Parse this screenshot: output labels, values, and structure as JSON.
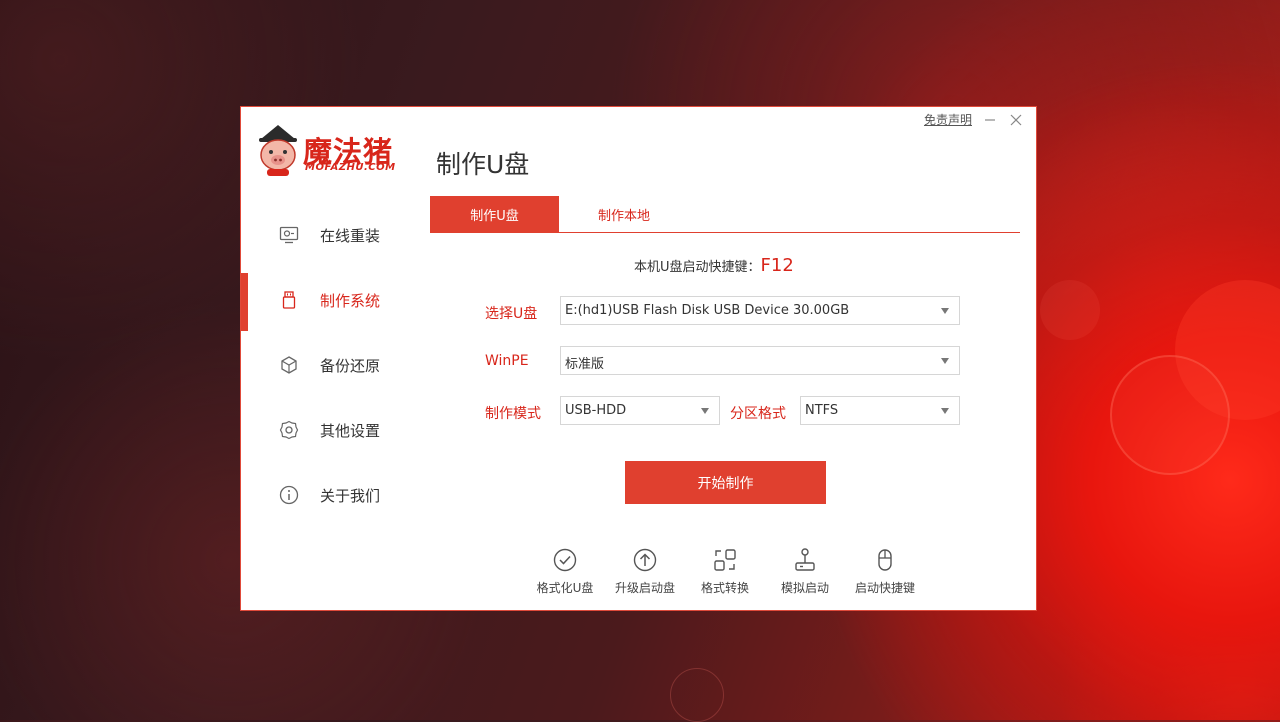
{
  "brand": {
    "logo_text": "魔法猪",
    "logo_sub": "MOFAZHU.COM",
    "accent_color": "#e0402f"
  },
  "window": {
    "title": "制作U盘",
    "disclaimer": "免责声明",
    "minimize_icon": "minimize-icon",
    "close_icon": "close-icon"
  },
  "sidebar": {
    "items": [
      {
        "label": "在线重装",
        "icon": "monitor-icon",
        "active": false
      },
      {
        "label": "制作系统",
        "icon": "usb-drive-icon",
        "active": true
      },
      {
        "label": "备份还原",
        "icon": "backup-cube-icon",
        "active": false
      },
      {
        "label": "其他设置",
        "icon": "gear-icon",
        "active": false
      },
      {
        "label": "关于我们",
        "icon": "info-icon",
        "active": false
      }
    ]
  },
  "tabs": [
    {
      "label": "制作U盘",
      "active": true
    },
    {
      "label": "制作本地",
      "active": false
    }
  ],
  "hotkey": {
    "label": "本机U盘启动快捷键：",
    "key": "F12"
  },
  "form": {
    "usb_label": "选择U盘",
    "usb_value": "E:(hd1)USB Flash Disk USB Device 30.00GB",
    "winpe_label": "WinPE",
    "winpe_value": "标准版",
    "mode_label": "制作模式",
    "mode_value": "USB-HDD",
    "partition_label": "分区格式",
    "partition_value": "NTFS"
  },
  "start_button": "开始制作",
  "tools": [
    {
      "label": "格式化U盘",
      "icon": "check-circle-icon"
    },
    {
      "label": "升级启动盘",
      "icon": "upload-circle-icon"
    },
    {
      "label": "格式转换",
      "icon": "convert-icon"
    },
    {
      "label": "模拟启动",
      "icon": "joystick-icon"
    },
    {
      "label": "启动快捷键",
      "icon": "mouse-icon"
    }
  ]
}
